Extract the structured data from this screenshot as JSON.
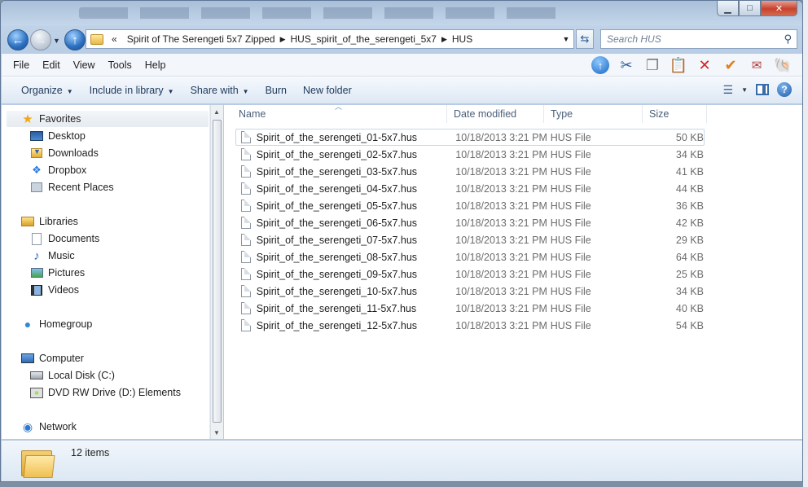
{
  "window": {
    "caption": {
      "minimize": "▁",
      "maximize": "□",
      "close": "✕"
    }
  },
  "nav": {
    "back": "←",
    "forward": "→",
    "up": "↑",
    "breadcrumb": [
      "«",
      "Spirit of The Serengeti 5x7 Zipped",
      "HUS_spirit_of_the_serengeti_5x7",
      "HUS"
    ],
    "search_placeholder": "Search HUS"
  },
  "menu": {
    "items": [
      "File",
      "Edit",
      "View",
      "Tools",
      "Help"
    ],
    "icons": [
      "upload-icon",
      "cut-icon",
      "copy-icon",
      "paste-icon",
      "delete-icon",
      "check-icon",
      "mail-icon",
      "shell-icon"
    ]
  },
  "commands": {
    "organize": "Organize",
    "include_library": "Include in library",
    "share_with": "Share with",
    "burn": "Burn",
    "new_folder": "New folder"
  },
  "sidebar": {
    "favorites": {
      "label": "Favorites",
      "items": [
        "Desktop",
        "Downloads",
        "Dropbox",
        "Recent Places"
      ]
    },
    "libraries": {
      "label": "Libraries",
      "items": [
        "Documents",
        "Music",
        "Pictures",
        "Videos"
      ]
    },
    "homegroup": "Homegroup",
    "computer": {
      "label": "Computer",
      "items": [
        "Local Disk (C:)",
        "DVD RW Drive (D:) Elements"
      ]
    },
    "network": "Network"
  },
  "columns": {
    "name": "Name",
    "date": "Date modified",
    "type": "Type",
    "size": "Size"
  },
  "files": [
    {
      "name": "Spirit_of_the_serengeti_01-5x7.hus",
      "date": "10/18/2013 3:21 PM",
      "type": "HUS File",
      "size": "50 KB"
    },
    {
      "name": "Spirit_of_the_serengeti_02-5x7.hus",
      "date": "10/18/2013 3:21 PM",
      "type": "HUS File",
      "size": "34 KB"
    },
    {
      "name": "Spirit_of_the_serengeti_03-5x7.hus",
      "date": "10/18/2013 3:21 PM",
      "type": "HUS File",
      "size": "41 KB"
    },
    {
      "name": "Spirit_of_the_serengeti_04-5x7.hus",
      "date": "10/18/2013 3:21 PM",
      "type": "HUS File",
      "size": "44 KB"
    },
    {
      "name": "Spirit_of_the_serengeti_05-5x7.hus",
      "date": "10/18/2013 3:21 PM",
      "type": "HUS File",
      "size": "36 KB"
    },
    {
      "name": "Spirit_of_the_serengeti_06-5x7.hus",
      "date": "10/18/2013 3:21 PM",
      "type": "HUS File",
      "size": "42 KB"
    },
    {
      "name": "Spirit_of_the_serengeti_07-5x7.hus",
      "date": "10/18/2013 3:21 PM",
      "type": "HUS File",
      "size": "29 KB"
    },
    {
      "name": "Spirit_of_the_serengeti_08-5x7.hus",
      "date": "10/18/2013 3:21 PM",
      "type": "HUS File",
      "size": "64 KB"
    },
    {
      "name": "Spirit_of_the_serengeti_09-5x7.hus",
      "date": "10/18/2013 3:21 PM",
      "type": "HUS File",
      "size": "25 KB"
    },
    {
      "name": "Spirit_of_the_serengeti_10-5x7.hus",
      "date": "10/18/2013 3:21 PM",
      "type": "HUS File",
      "size": "34 KB"
    },
    {
      "name": "Spirit_of_the_serengeti_11-5x7.hus",
      "date": "10/18/2013 3:21 PM",
      "type": "HUS File",
      "size": "40 KB"
    },
    {
      "name": "Spirit_of_the_serengeti_12-5x7.hus",
      "date": "10/18/2013 3:21 PM",
      "type": "HUS File",
      "size": "54 KB"
    }
  ],
  "status": {
    "item_count": "12 items"
  }
}
